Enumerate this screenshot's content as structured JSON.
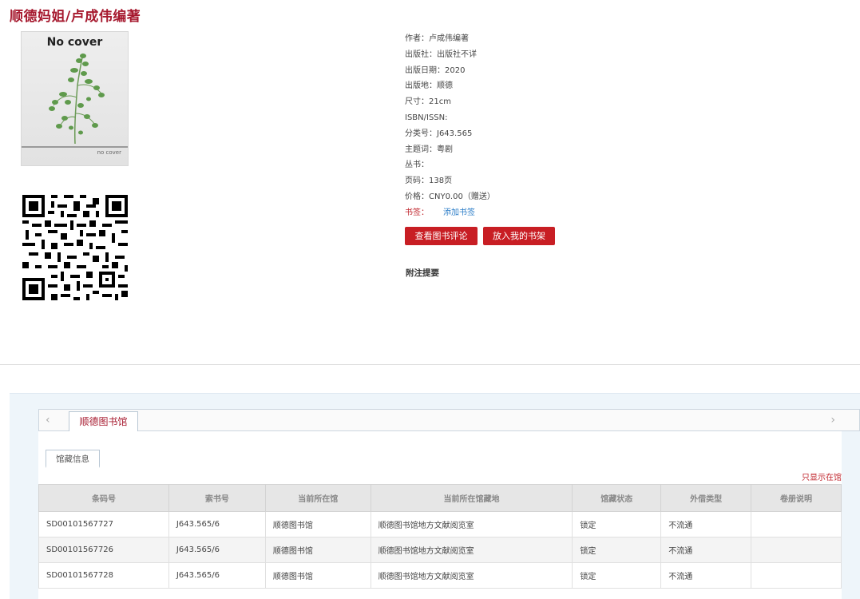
{
  "book": {
    "title": "顺德妈姐",
    "title_sep": "/",
    "author_line": "卢成伟编著",
    "cover_text_large": "No cover",
    "cover_text_small": "no cover"
  },
  "meta": [
    {
      "label": "作者：",
      "value": "卢成伟编著"
    },
    {
      "label": "出版社：",
      "value": "出版社不详"
    },
    {
      "label": "出版日期：",
      "value": "2020"
    },
    {
      "label": "出版地：",
      "value": "顺德"
    },
    {
      "label": "尺寸：",
      "value": "21cm"
    },
    {
      "label": "ISBN/ISSN:",
      "value": ""
    },
    {
      "label": "分类号：",
      "value": "J643.565"
    },
    {
      "label": "主题词：",
      "value": "粤剧"
    },
    {
      "label": "丛书：",
      "value": ""
    },
    {
      "label": "页码：",
      "value": "138页"
    },
    {
      "label": "价格：",
      "value": "CNY0.00（赠送）"
    }
  ],
  "bookmark": {
    "label": "书签：",
    "link": "添加书签"
  },
  "buttons": {
    "review": "查看图书评论",
    "shelf": "放入我的书架"
  },
  "abstract_label": "附注提要",
  "holdings": {
    "arrow_left": "‹",
    "arrow_right": "›",
    "library_tab": "顺德图书馆",
    "info_tab": "馆藏信息",
    "only_here": "只显示在馆",
    "columns": [
      "条码号",
      "索书号",
      "当前所在馆",
      "当前所在馆藏地",
      "馆藏状态",
      "外借类型",
      "卷册说明"
    ],
    "rows": [
      [
        "SD00101567727",
        "J643.565/6",
        "顺德图书馆",
        "顺德图书馆地方文献阅览室",
        "锁定",
        "不流通",
        ""
      ],
      [
        "SD00101567726",
        "J643.565/6",
        "顺德图书馆",
        "顺德图书馆地方文献阅览室",
        "锁定",
        "不流通",
        ""
      ],
      [
        "SD00101567728",
        "J643.565/6",
        "顺德图书馆",
        "顺德图书馆地方文献阅览室",
        "锁定",
        "不流通",
        ""
      ]
    ]
  },
  "colors": {
    "brand_red": "#a6192e",
    "button_red": "#c81e24",
    "link_blue": "#2a7cc7"
  }
}
